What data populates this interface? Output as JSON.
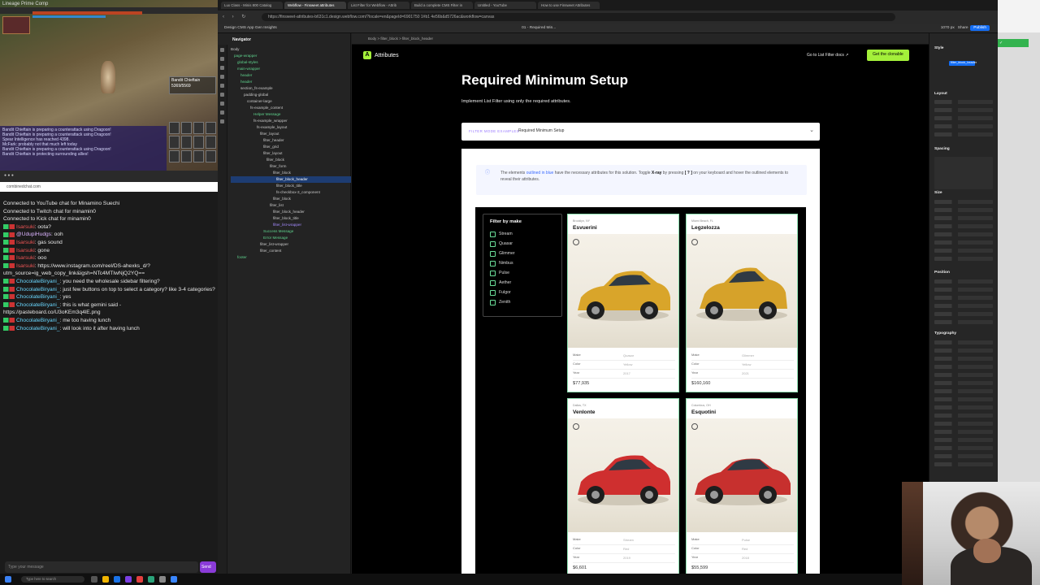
{
  "game": {
    "window_title": "Lineage Prime Comp",
    "boss_name": "Bandit Chieftain",
    "boss_hp": "5369/5569",
    "chat_lines": [
      "Bandit Chieftain is preparing a counterattack using Dragoon!",
      "Bandit Chieftain is preparing a counterattack using Dragoon!",
      "Spear Intelligence has reached 4398.",
      "McFark: probably not that much left today",
      "Bandit Chieftain is preparing a counterattack using Dragoon!",
      "Bandit Chieftain is protecting surrounding allies!"
    ]
  },
  "chat": {
    "url": "combinedchat.com",
    "system_messages": [
      "Connected to YouTube chat for Minamino Suechi",
      "Connected to Twitch chat for minamin0",
      "Connected to Kick chat for minamin0"
    ],
    "messages": [
      {
        "user": "Isarsuki",
        "style": "u",
        "text": "oota?"
      },
      {
        "user": "@UdupiHudgs",
        "style": "u3",
        "text": "ooh"
      },
      {
        "user": "Isarsuki",
        "style": "u",
        "text": "gas sound"
      },
      {
        "user": "Isarsuki",
        "style": "u",
        "text": "gone"
      },
      {
        "user": "Isarsuki",
        "style": "u",
        "text": "ooo"
      },
      {
        "user": "Isarsuki",
        "style": "u",
        "text": "https://www.instagram.com/reel/DS-ahexks_d/?utm_source=ig_web_copy_link&igsh=NTc4MTIwNjQ2YQ=="
      },
      {
        "user": "ChocolateBiryani_",
        "style": "u2",
        "text": "you need the wholesale sidebar filtering?"
      },
      {
        "user": "ChocolateBiryani_",
        "style": "u2",
        "text": "just few buttons on top to select a category? like 3-4 categories?"
      },
      {
        "user": "ChocolateBiryani_",
        "style": "u2",
        "text": "yes"
      },
      {
        "user": "ChocolateBiryani_",
        "style": "u2",
        "text": "this is what gemini said - https://pasteboard.co/U3oKEm3q4lE.png"
      },
      {
        "user": "ChocolateBiryani_",
        "style": "u2",
        "text": "me too having lunch"
      },
      {
        "user": "ChocolateBiryani_",
        "style": "u2",
        "text": "will look into it after having lunch"
      }
    ],
    "input_placeholder": "Type your message",
    "send_label": "Send"
  },
  "browser": {
    "tabs": [
      "Lux Class - Minis 800 Catalog",
      "Webflow - Finsweet attributes",
      "List Filter for Webflow - Attrib",
      "Build a complete CMS Filter in",
      "Untitled - YouTube",
      "How to use Finsweet Attributes"
    ],
    "url": "https://finsweet-attributes-b631c1.design.webflow.com/?locale=en&pageId=6901750 1#b1 4e56b&d5726ac&workflow=canvas"
  },
  "designer": {
    "topbar_left": "Design   CMS   App Gen   Insights",
    "topbar_mid": "01 - Required Min...",
    "zoom": "1070 px",
    "share": "Share",
    "publish": "Publish",
    "navigator_title": "Navigator",
    "breadcrumb": "Body  >  filter_block  >  filter_block_header",
    "tree": [
      {
        "label": "Body",
        "indent": 0,
        "cls": ""
      },
      {
        "label": "page-wrapper",
        "indent": 1,
        "cls": "g"
      },
      {
        "label": "global-styles",
        "indent": 2,
        "cls": "g"
      },
      {
        "label": "main-wrapper",
        "indent": 2,
        "cls": "g"
      },
      {
        "label": "header",
        "indent": 3,
        "cls": "g"
      },
      {
        "label": "header",
        "indent": 3,
        "cls": "g"
      },
      {
        "label": "section_fs-example",
        "indent": 3,
        "cls": ""
      },
      {
        "label": "padding-global",
        "indent": 4,
        "cls": ""
      },
      {
        "label": "container-large",
        "indent": 5,
        "cls": ""
      },
      {
        "label": "fs-example_content",
        "indent": 6,
        "cls": ""
      },
      {
        "label": "Helper Message",
        "indent": 7,
        "cls": "g"
      },
      {
        "label": "fs-example_wrapper",
        "indent": 7,
        "cls": ""
      },
      {
        "label": "fs-example_layout",
        "indent": 8,
        "cls": ""
      },
      {
        "label": "filter_layout",
        "indent": 9,
        "cls": ""
      },
      {
        "label": "filter_header",
        "indent": 10,
        "cls": ""
      },
      {
        "label": "filter_grid",
        "indent": 10,
        "cls": ""
      },
      {
        "label": "filter_layout",
        "indent": 10,
        "cls": ""
      },
      {
        "label": "filter_block",
        "indent": 11,
        "cls": ""
      },
      {
        "label": "filter_form",
        "indent": 12,
        "cls": ""
      },
      {
        "label": "filter_block",
        "indent": 13,
        "cls": ""
      },
      {
        "label": "filter_block_header",
        "indent": 14,
        "cls": "sel"
      },
      {
        "label": "filter_block_title",
        "indent": 14,
        "cls": ""
      },
      {
        "label": "fs-checkbox-3_component",
        "indent": 14,
        "cls": ""
      },
      {
        "label": "filter_block",
        "indent": 13,
        "cls": ""
      },
      {
        "label": "filter_list",
        "indent": 12,
        "cls": ""
      },
      {
        "label": "filter_block_header",
        "indent": 13,
        "cls": ""
      },
      {
        "label": "filter_block_title",
        "indent": 13,
        "cls": ""
      },
      {
        "label": "filter_list-wrapper",
        "indent": 13,
        "cls": "p"
      },
      {
        "label": "Success Message",
        "indent": 10,
        "cls": "g"
      },
      {
        "label": "Error Message",
        "indent": 10,
        "cls": "g"
      },
      {
        "label": "filter_list-wrapper",
        "indent": 9,
        "cls": ""
      },
      {
        "label": "filter_content",
        "indent": 9,
        "cls": ""
      },
      {
        "label": "footer",
        "indent": 2,
        "cls": "g"
      }
    ]
  },
  "site": {
    "logo_mark": "A",
    "logo_text": "Attributes",
    "doc_link": "Go to List Filter docs ↗",
    "cta_label": "Get the clonable",
    "page_title": "Required Minimum Setup",
    "page_subtitle": "Implement List Filter using only the required attributes.",
    "accordion_tag": "FILTER MODE EXAMPLES",
    "accordion_label": "Required Minimum Setup",
    "notice_parts": {
      "a": "The elements ",
      "b": "outlined in blue",
      "c": " have the necessary attributes for this solution. Toggle ",
      "d": "X-ray",
      "e": " by pressing ",
      "f": "[ ? ]",
      "g": " on your keyboard and hover the outlined elements to reveal their attributes."
    },
    "filter_title": "Filter by make",
    "filter_options": [
      "Stream",
      "Quasar",
      "Glimmer",
      "Nimbus",
      "Pulse",
      "Aether",
      "Fulgor",
      "Zenith"
    ],
    "cars": [
      {
        "location": "Brooklyn, NY",
        "name": "Esvuerini",
        "make": "Quasar",
        "color": "Yellow",
        "year": "2017",
        "price": "$77,935",
        "body": "#d9a52a",
        "car": "hatch"
      },
      {
        "location": "Miami Beach, FL",
        "name": "Legzelozza",
        "make": "Glimmer",
        "color": "Yellow",
        "year": "2021",
        "price": "$160,160",
        "body": "#d6a22a",
        "car": "mini"
      },
      {
        "location": "Dallas, TX",
        "name": "Venlonte",
        "make": "Stream",
        "color": "Red",
        "year": "2019",
        "price": "$6,601",
        "body": "#cf2f2f",
        "car": "hatch"
      },
      {
        "location": "Columbus, OH",
        "name": "Esquotini",
        "make": "Pulse",
        "color": "Red",
        "year": "2018",
        "price": "$55,599",
        "body": "#c7302e",
        "car": "sedan"
      }
    ],
    "field_labels": {
      "make": "Make",
      "color": "Color",
      "year": "Year"
    }
  },
  "style_panel": {
    "sections": [
      "Style",
      "Layout",
      "Spacing",
      "Size",
      "Position",
      "Typography"
    ],
    "selector": "filter_block_header",
    "accent": "#146ef5"
  },
  "taskbar": {
    "search_placeholder": "Type here to search"
  },
  "colors": {
    "accent_green": "#a4f03a",
    "outline": "#8de0b0",
    "tree_green": "#5fd38d",
    "tree_purple": "#a58bff"
  }
}
